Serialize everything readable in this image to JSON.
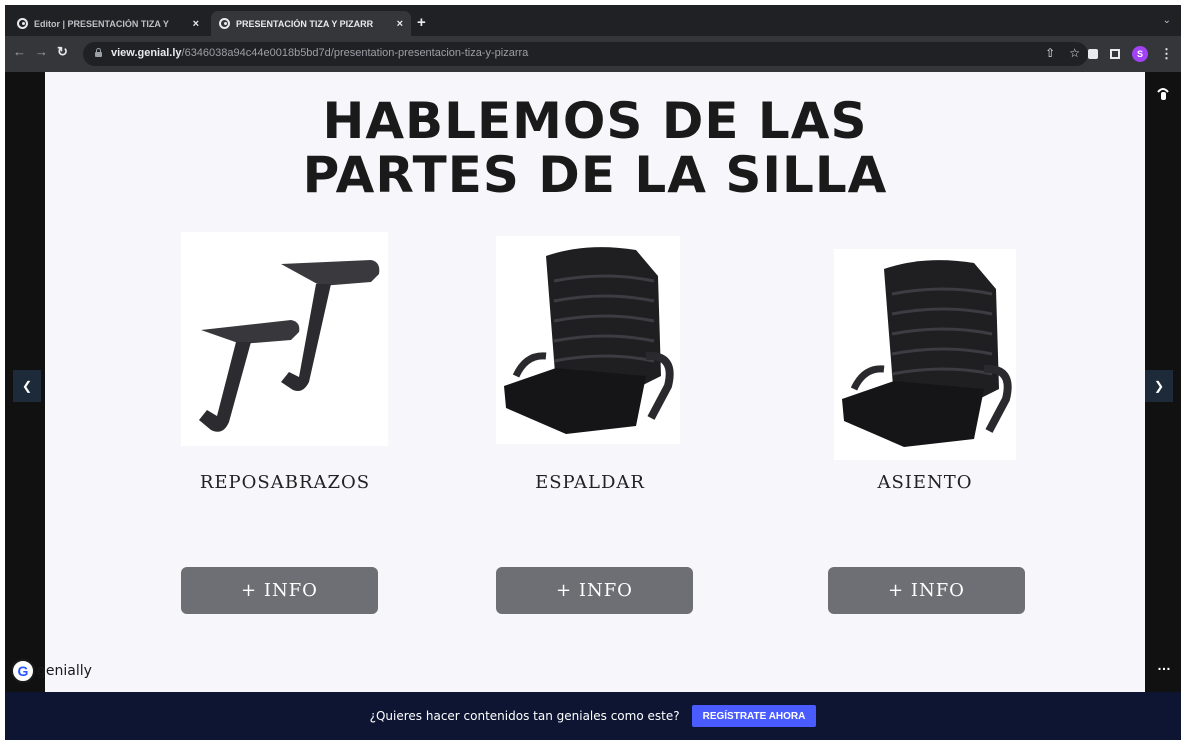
{
  "browser": {
    "tabs": [
      {
        "title": "Editor | PRESENTACIÓN TIZA Y",
        "active": false
      },
      {
        "title": "PRESENTACIÓN TIZA Y PIZARR",
        "active": true
      }
    ],
    "new_tab": "+",
    "close": "×",
    "url_host": "view.genial.ly",
    "url_path": "/6346038a94c44e0018b5bd7d/presentation-presentacion-tiza-y-pizarra",
    "profile_initial": "S"
  },
  "slide": {
    "title_line1": "HABLEMOS DE LAS",
    "title_line2": "PARTES DE LA SILLA",
    "cards": [
      {
        "label": "REPOSABRAZOS",
        "button": "+ INFO",
        "image": "armrests-image"
      },
      {
        "label": "ESPALDAR",
        "button": "+ INFO",
        "image": "chair-cushion-image"
      },
      {
        "label": "ASIENTO",
        "button": "+ INFO",
        "image": "chair-cushion-image"
      }
    ]
  },
  "viewer": {
    "prev_icon": "chevron-left-icon",
    "next_icon": "chevron-right-icon",
    "more_icon": "more-dots-icon",
    "brand_text": "genially"
  },
  "banner": {
    "text": "¿Quieres hacer contenidos tan geniales como este?",
    "cta": "REGÍSTRATE AHORA"
  },
  "colors": {
    "slide_bg": "#f7f6fb",
    "info_button": "#6e6e75",
    "banner_bg": "#0d1533",
    "cta_bg": "#4a5cff"
  }
}
